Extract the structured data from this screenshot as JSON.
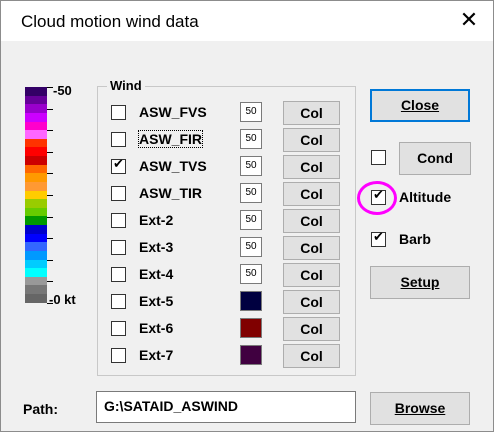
{
  "window": {
    "title": "Cloud motion wind data",
    "close_glyph": "✕"
  },
  "scale": {
    "max_label": "-50",
    "min_label": "-0 kt",
    "colors": [
      "#330066",
      "#660099",
      "#9900cc",
      "#cc00ff",
      "#ff00cc",
      "#ff66ff",
      "#ff3300",
      "#ff0000",
      "#cc0000",
      "#ff6600",
      "#ff9900",
      "#ff9933",
      "#ffcc00",
      "#99cc00",
      "#66cc00",
      "#009900",
      "#0000cc",
      "#0000ff",
      "#3366ff",
      "#0099ff",
      "#00ccff",
      "#00ffff",
      "#999999",
      "#777777",
      "#666666"
    ]
  },
  "wind": {
    "group_label": "Wind",
    "col_label": "Col",
    "rows": [
      {
        "label": "ASW_FVS",
        "checked": false,
        "num": "50",
        "swatch": null
      },
      {
        "label": "ASW_FIR",
        "checked": false,
        "num": "50",
        "swatch": null
      },
      {
        "label": "ASW_TVS",
        "checked": true,
        "num": "50",
        "swatch": null
      },
      {
        "label": "ASW_TIR",
        "checked": false,
        "num": "50",
        "swatch": null
      },
      {
        "label": "Ext-2",
        "checked": false,
        "num": "50",
        "swatch": null
      },
      {
        "label": "Ext-3",
        "checked": false,
        "num": "50",
        "swatch": null
      },
      {
        "label": "Ext-4",
        "checked": false,
        "num": "50",
        "swatch": null
      },
      {
        "label": "Ext-5",
        "checked": false,
        "num": null,
        "swatch": "#000040"
      },
      {
        "label": "Ext-6",
        "checked": false,
        "num": null,
        "swatch": "#800000"
      },
      {
        "label": "Ext-7",
        "checked": false,
        "num": null,
        "swatch": "#400040"
      }
    ]
  },
  "right": {
    "close_label": "Close",
    "cond_label": "Cond",
    "cond_checked": false,
    "altitude_label": "Altitude",
    "altitude_checked": true,
    "barb_label": "Barb",
    "barb_checked": true,
    "setup_label": "Setup"
  },
  "path": {
    "label": "Path:",
    "value": "G:\\SATAID_ASWIND"
  },
  "browse_label": "Browse",
  "highlight_color": "#ff00ff"
}
